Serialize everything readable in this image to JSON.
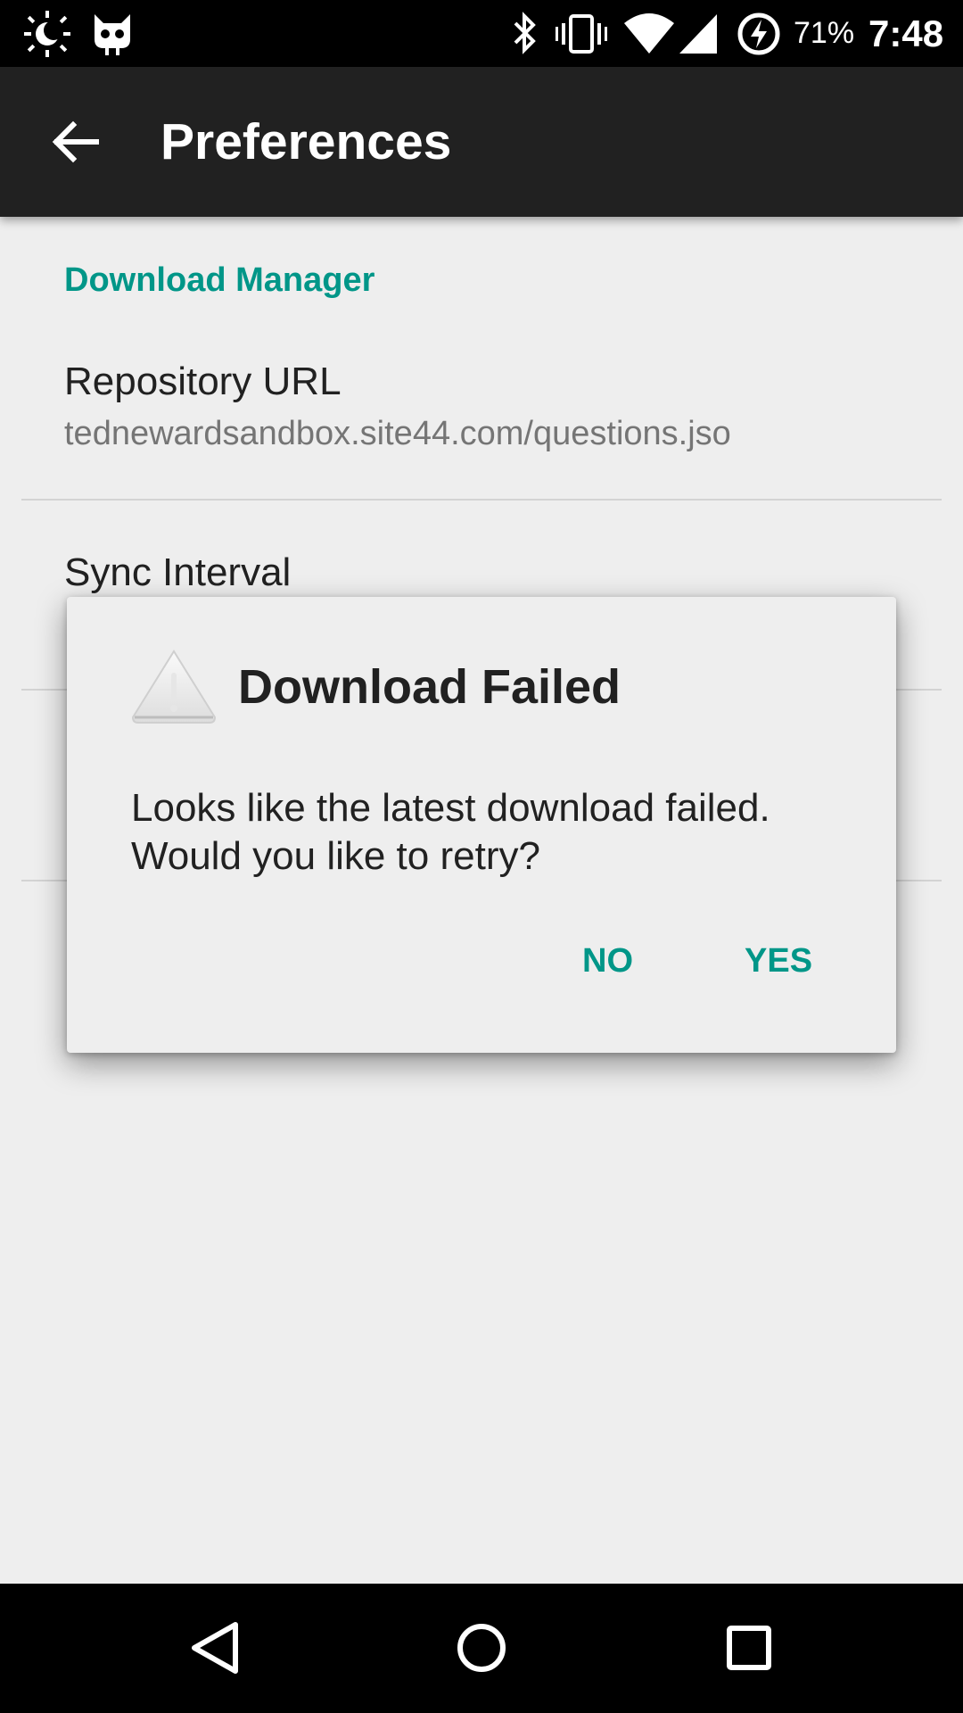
{
  "status_bar": {
    "battery_percent": "71%",
    "time": "7:48",
    "icons": [
      "brightness-auto-icon",
      "cyanogen-mascot-icon",
      "bluetooth-icon",
      "vibrate-icon",
      "wifi-icon",
      "cell-signal-icon",
      "battery-charging-icon"
    ]
  },
  "app_bar": {
    "title": "Preferences",
    "back_icon": "arrow-back-icon"
  },
  "preferences": {
    "category": "Download Manager",
    "items": [
      {
        "title": "Repository URL",
        "summary": "tednewardsandbox.site44.com/questions.jso"
      },
      {
        "title": "Sync Interval",
        "summary": ""
      }
    ]
  },
  "dialog": {
    "icon": "warning-icon",
    "title": "Download Failed",
    "message": "Looks like the latest download failed. Would you like to retry?",
    "negative_label": "NO",
    "positive_label": "YES"
  },
  "nav_bar": {
    "back": "back-triangle-icon",
    "home": "home-circle-icon",
    "recents": "recents-square-icon"
  },
  "colors": {
    "accent": "#009688",
    "app_bar": "#212121",
    "background": "#eeeeee"
  }
}
